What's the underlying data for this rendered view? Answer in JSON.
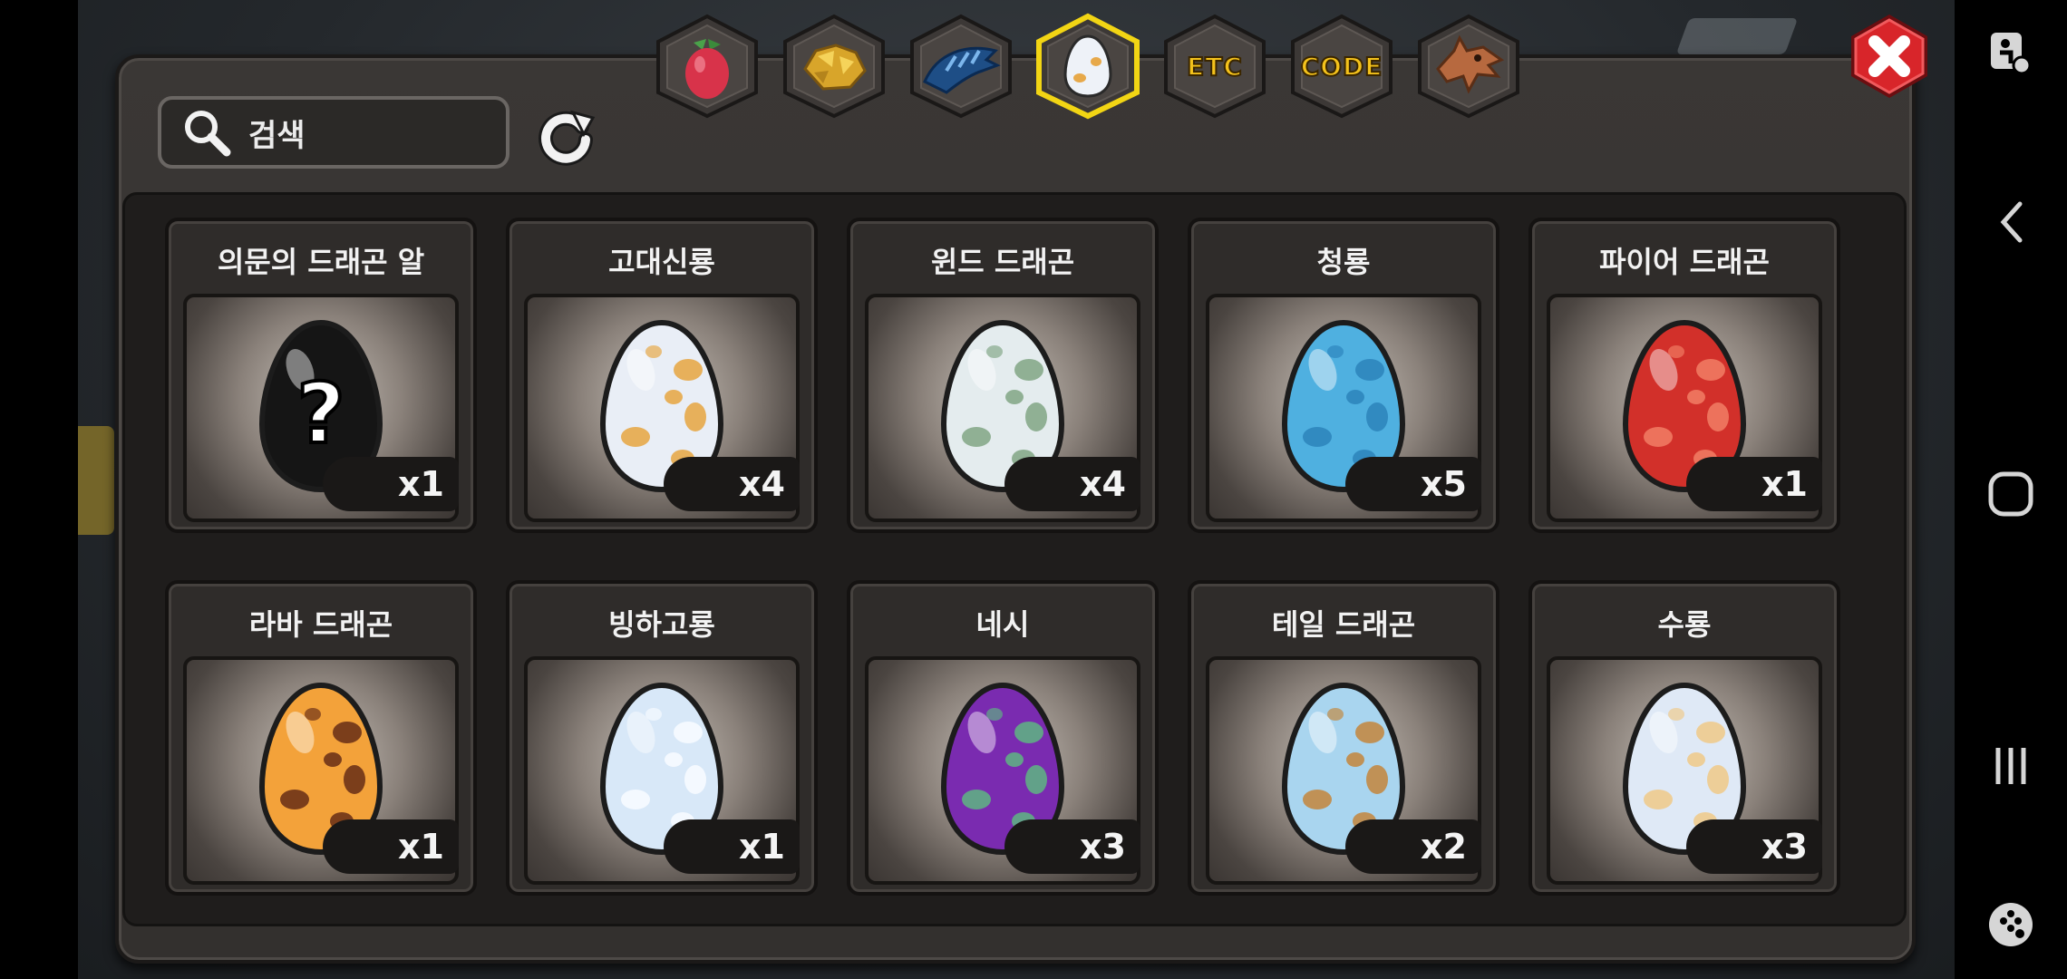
{
  "search": {
    "placeholder": "검색",
    "icon": "search-icon"
  },
  "refresh": {
    "icon": "refresh-icon"
  },
  "close": {
    "icon": "close-icon",
    "color": "#d8252a"
  },
  "tabs": [
    {
      "id": "fruit",
      "icon": "fruit-icon",
      "label": "",
      "active": false
    },
    {
      "id": "gold",
      "icon": "gold-nugget-icon",
      "label": "",
      "active": false
    },
    {
      "id": "dragon",
      "icon": "blue-dragon-icon",
      "label": "",
      "active": false
    },
    {
      "id": "egg",
      "icon": "egg-icon",
      "label": "",
      "active": true
    },
    {
      "id": "etc",
      "icon": "",
      "label": "ETC",
      "active": false
    },
    {
      "id": "code",
      "icon": "",
      "label": "CODE",
      "active": false
    },
    {
      "id": "dragon-head",
      "icon": "dragon-head-icon",
      "label": "",
      "active": false
    }
  ],
  "eggs": [
    {
      "name": "의문의 드래곤 알",
      "qty": "x1",
      "base": "#151515",
      "spot": "#2a2a2a",
      "mystery": true
    },
    {
      "name": "고대신룡",
      "qty": "x4",
      "base": "#e9eef6",
      "spot": "#e7a94a",
      "mystery": false
    },
    {
      "name": "윈드 드래곤",
      "qty": "x4",
      "base": "#e4ecee",
      "spot": "#86aa8a",
      "mystery": false
    },
    {
      "name": "청룡",
      "qty": "x5",
      "base": "#4fb0e0",
      "spot": "#2e86bd",
      "mystery": false
    },
    {
      "name": "파이어 드래곤",
      "qty": "x1",
      "base": "#d2302a",
      "spot": "#ef7a62",
      "mystery": false
    },
    {
      "name": "라바 드래곤",
      "qty": "x1",
      "base": "#f3a23a",
      "spot": "#6e3318",
      "mystery": false
    },
    {
      "name": "빙하고룡",
      "qty": "x1",
      "base": "#d8e8f8",
      "spot": "#f7fbff",
      "mystery": false
    },
    {
      "name": "네시",
      "qty": "x3",
      "base": "#7a2bb0",
      "spot": "#5fae85",
      "mystery": false
    },
    {
      "name": "테일 드래곤",
      "qty": "x2",
      "base": "#a9d5ef",
      "spot": "#c28a45",
      "mystery": false
    },
    {
      "name": "수룡",
      "qty": "x3",
      "base": "#dfe9f6",
      "spot": "#eecb8e",
      "mystery": false
    }
  ],
  "navbar": {
    "items": [
      {
        "icon": "accessibility-icon"
      },
      {
        "icon": "back-icon"
      },
      {
        "icon": "home-icon"
      },
      {
        "icon": "recents-icon"
      },
      {
        "icon": "game-tools-icon"
      }
    ]
  }
}
